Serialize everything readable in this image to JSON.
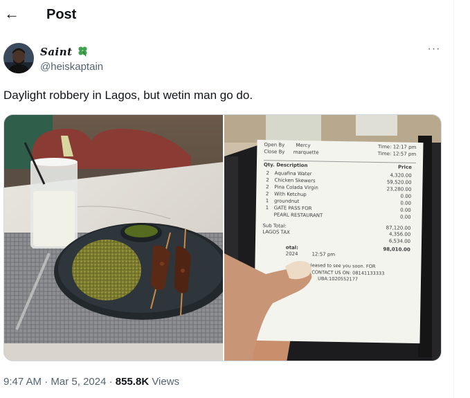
{
  "header": {
    "back_icon": "arrow-left-icon",
    "title": "Post"
  },
  "author": {
    "name": "Saint",
    "badge_icon": "four-leaf-clover-icon",
    "handle": "@heiskaptain"
  },
  "more_label": "···",
  "tweet": {
    "text": "Daylight robbery in Lagos, but wetin man go do."
  },
  "receipt": {
    "open_by_label": "Open By",
    "open_by": "Mercy",
    "close_by_label": "Close By",
    "close_by": "marquette",
    "time_label": "Time:",
    "time_open": "12:17 pm",
    "time_close": "12:57 pm",
    "qty_desc_header": "Qty. Description",
    "price_header": "Price",
    "items": [
      {
        "qty": "2",
        "desc": "Aquafina Water",
        "price": "4,320.00"
      },
      {
        "qty": "2",
        "desc": "Chicken Skewers",
        "price": "59,520.00"
      },
      {
        "qty": "2",
        "desc": "Pina Colada Virgin",
        "price": "23,280.00"
      },
      {
        "qty": "2",
        "desc": "With Ketchup",
        "price": "0.00"
      },
      {
        "qty": "1",
        "desc": "groundnut",
        "price": "0.00"
      },
      {
        "qty": "1",
        "desc": "GATE PASS FOR",
        "price": "0.00"
      },
      {
        "qty": "",
        "desc": "PEARL RESTAURANT",
        "price": "0.00"
      }
    ],
    "subtotal_label": "Sub Total:",
    "subtotal": "87,120.00",
    "tax_label": "LAGOS TAX",
    "tax1": "4,356.00",
    "tax2": "6,534.00",
    "total_label": "otal:",
    "total": "98,010.00",
    "date_fragment": "2024",
    "date_time": "12:57 pm",
    "footer1": "be pleased to see you soon. FOR",
    "footer2": "DETAILS CONTACT US ON: 08141133333",
    "footer3": "UBA:1020552177"
  },
  "meta": {
    "time": "9:47 AM",
    "sep1": "·",
    "date": "Mar 5, 2024",
    "sep2": "·",
    "views_count": "855.8K",
    "views_label": "Views"
  }
}
